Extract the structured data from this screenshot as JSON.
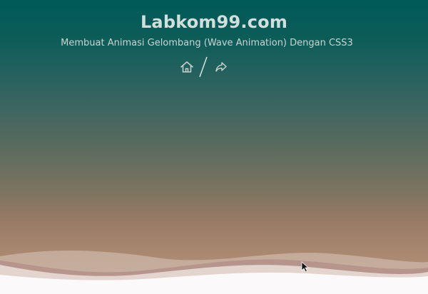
{
  "header": {
    "title": "Labkom99.com",
    "subtitle": "Membuat Animasi Gelombang (Wave Animation) Dengan CSS3"
  },
  "nav": {
    "home_icon": "home-icon",
    "separator": "slash-divider",
    "forward_icon": "share-forward-icon"
  },
  "colors": {
    "bg_top": "#005a57",
    "bg_bottom": "#b69580",
    "title": "#d3dfdc",
    "wave_fill": "#ffffff",
    "wave_shadow": "#9b6a73"
  }
}
